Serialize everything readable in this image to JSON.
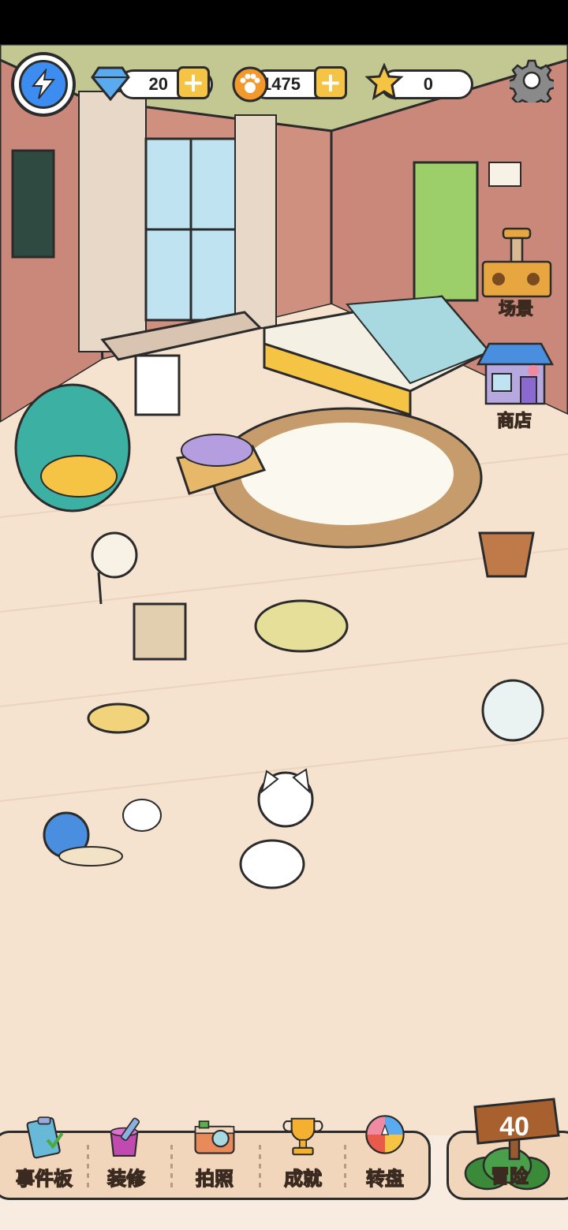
{
  "hud": {
    "energy_icon": "lightning-bolt-icon",
    "diamonds": "20",
    "coins": "1475",
    "stars": "0",
    "settings_icon": "gear-icon"
  },
  "side_buttons": {
    "scene_label": "场景",
    "shop_label": "商店"
  },
  "nav": {
    "items": [
      {
        "label": "事件板",
        "icon": "clipboard-icon"
      },
      {
        "label": "装修",
        "icon": "paint-bucket-icon"
      },
      {
        "label": "拍照",
        "icon": "camera-icon"
      },
      {
        "label": "成就",
        "icon": "trophy-icon"
      },
      {
        "label": "转盘",
        "icon": "wheel-icon"
      }
    ],
    "adventure": {
      "label": "冒险",
      "level": "40"
    }
  },
  "colors": {
    "wall": "#c9887a",
    "floor": "#f5e2cf",
    "accent_yellow": "#f6c444",
    "energy_blue": "#3d8cf0",
    "outline": "#2b2b2b"
  }
}
